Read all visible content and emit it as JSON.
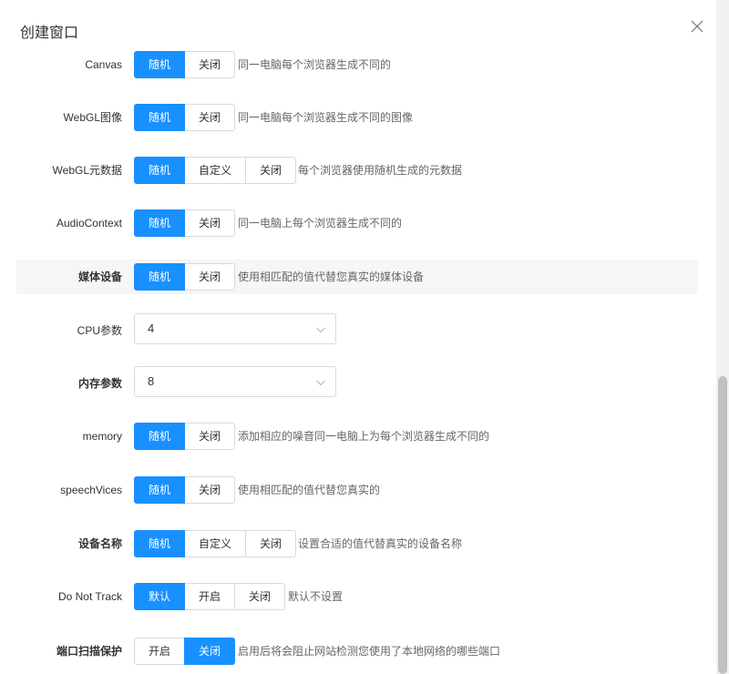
{
  "dialog": {
    "title": "创建窗口"
  },
  "rows": {
    "canvas": {
      "label": "Canvas",
      "options": [
        "随机",
        "关闭"
      ],
      "active": 0,
      "desc": "同一电脑每个浏览器生成不同的"
    },
    "webgl_image": {
      "label": "WebGL图像",
      "options": [
        "随机",
        "关闭"
      ],
      "active": 0,
      "desc": "同一电脑每个浏览器生成不同的图像"
    },
    "webgl_meta": {
      "label": "WebGL元数据",
      "options": [
        "随机",
        "自定义",
        "关闭"
      ],
      "active": 0,
      "desc": "每个浏览器使用随机生成的元数据"
    },
    "audio": {
      "label": "AudioContext",
      "options": [
        "随机",
        "关闭"
      ],
      "active": 0,
      "desc": "同一电脑上每个浏览器生成不同的"
    },
    "media": {
      "label": "媒体设备",
      "options": [
        "随机",
        "关闭"
      ],
      "active": 0,
      "desc": "使用相匹配的值代替您真实的媒体设备"
    },
    "cpu": {
      "label": "CPU参数",
      "value": "4"
    },
    "mem": {
      "label": "内存参数",
      "value": "8"
    },
    "memory": {
      "label": "memory",
      "options": [
        "随机",
        "关闭"
      ],
      "active": 0,
      "desc": "添加相应的噪音同一电脑上为每个浏览器生成不同的"
    },
    "speech": {
      "label": "speechVices",
      "options": [
        "随机",
        "关闭"
      ],
      "active": 0,
      "desc": "使用相匹配的值代替您真实的"
    },
    "device_name": {
      "label": "设备名称",
      "options": [
        "随机",
        "自定义",
        "关闭"
      ],
      "active": 0,
      "desc": "设置合适的值代替真实的设备名称"
    },
    "dnt": {
      "label": "Do Not Track",
      "options": [
        "默认",
        "开启",
        "关闭"
      ],
      "active": 0,
      "desc": "默认不设置"
    },
    "port": {
      "label": "端口扫描保护",
      "options": [
        "开启",
        "关闭"
      ],
      "active": 1,
      "desc": "启用后将会阻止网站检测您使用了本地网络的哪些端口"
    }
  },
  "icons": {
    "close": "close-icon",
    "chevron": "chevron-down-icon"
  },
  "colors": {
    "accent": "#1890ff",
    "highlight_row": "#f5f6f8"
  }
}
